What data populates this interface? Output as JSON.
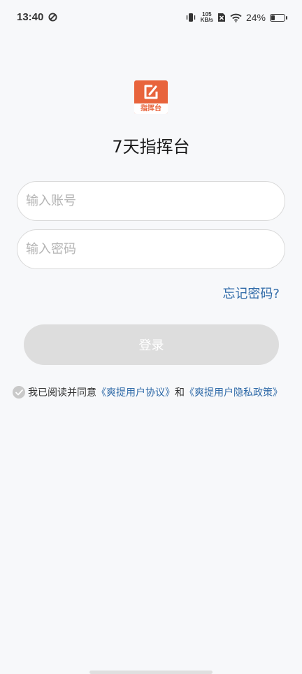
{
  "status_bar": {
    "time": "13:40",
    "net_speed_value": "105",
    "net_speed_unit": "KB/s",
    "battery_text": "24%",
    "battery_level": 0.24,
    "icons": [
      "sync-icon",
      "vibrate-icon",
      "no-sim-icon",
      "wifi-icon",
      "battery-icon"
    ]
  },
  "logo": {
    "caption": "指挥台",
    "brand_color": "#e8643c"
  },
  "app_title": "7天指挥台",
  "form": {
    "account_placeholder": "输入账号",
    "account_value": "",
    "password_placeholder": "输入密码",
    "password_value": "",
    "forgot_password": "忘记密码?",
    "login_label": "登录"
  },
  "agreement": {
    "prefix": "我已阅读并同意",
    "user_agreement": "《爽提用户协议》",
    "conjunction": "和",
    "privacy_policy": "《爽提用户隐私政策》",
    "accent_color": "#2f6aa8"
  }
}
